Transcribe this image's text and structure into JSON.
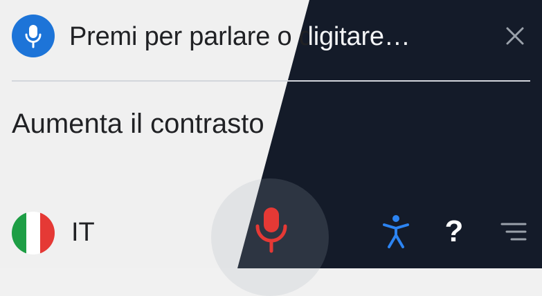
{
  "search": {
    "placeholder": "Premi per parlare o digitare…"
  },
  "command": {
    "text": "Aumenta il contrasto"
  },
  "language": {
    "code": "IT"
  },
  "help": {
    "glyph": "?"
  },
  "icons": {
    "voice_badge": "microphone-icon",
    "close": "close-icon",
    "flag": "italy-flag-icon",
    "record": "microphone-icon",
    "accessibility": "accessibility-icon",
    "help": "help-icon",
    "menu": "menu-icon"
  },
  "colors": {
    "light_background": "#f0f0f0",
    "dark_background": "#141b29",
    "accent_blue": "#1d74d8",
    "record_red": "#e53935",
    "italy_green": "#1e9e45",
    "italy_white": "#ffffff",
    "italy_red": "#e53935"
  }
}
